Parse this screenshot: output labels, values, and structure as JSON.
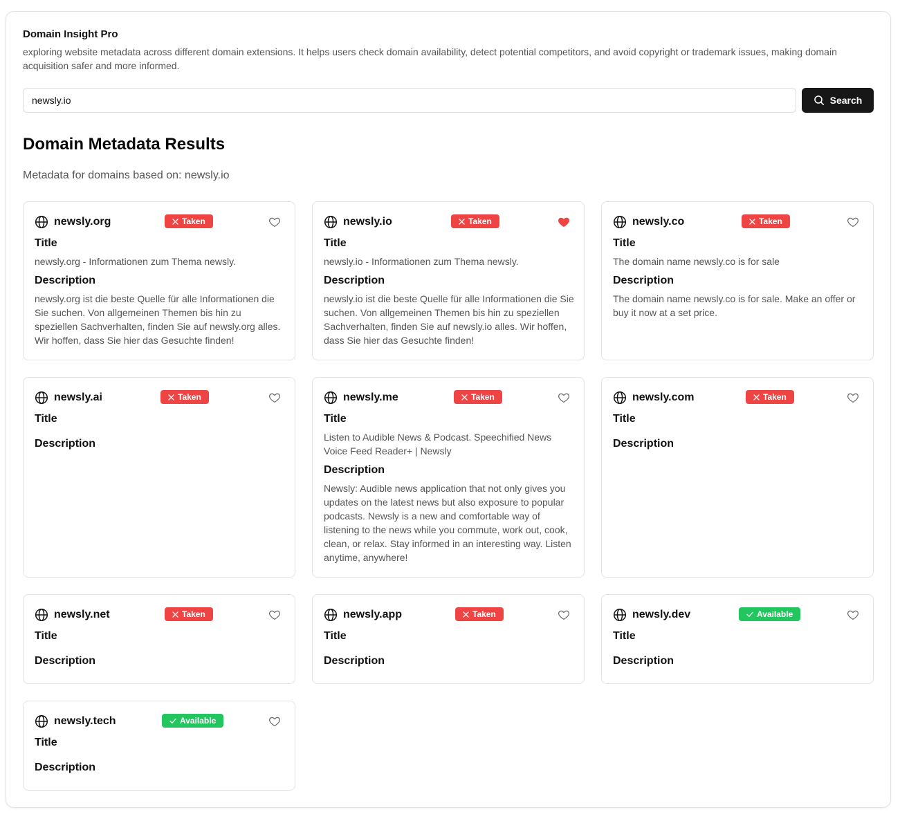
{
  "app": {
    "title": "Domain Insight Pro",
    "description": "exploring website metadata across different domain extensions. It helps users check domain availability, detect potential competitors, and avoid copyright or trademark issues, making domain acquisition safer and more informed."
  },
  "search": {
    "value": "newsly.io",
    "placeholder": "",
    "button_label": "Search"
  },
  "results": {
    "heading": "Domain Metadata Results",
    "subtitle_prefix": "Metadata for domains based on: ",
    "subtitle_query": "newsly.io"
  },
  "labels": {
    "title": "Title",
    "description": "Description"
  },
  "colors": {
    "taken": "#ef4444",
    "available": "#22c55e",
    "favorite": "#ef4444",
    "button": "#171717"
  },
  "cards": [
    {
      "domain": "newsly.org",
      "status": "Taken",
      "favorite": false,
      "title": "newsly.org - Informationen zum Thema newsly.",
      "description": "newsly.org ist die beste Quelle für alle Informationen die Sie suchen. Von allgemeinen Themen bis hin zu speziellen Sachverhalten, finden Sie auf newsly.org alles. Wir hoffen, dass Sie hier das Gesuchte finden!"
    },
    {
      "domain": "newsly.io",
      "status": "Taken",
      "favorite": true,
      "title": "newsly.io - Informationen zum Thema newsly.",
      "description": "newsly.io ist die beste Quelle für alle Informationen die Sie suchen. Von allgemeinen Themen bis hin zu speziellen Sachverhalten, finden Sie auf newsly.io alles. Wir hoffen, dass Sie hier das Gesuchte finden!"
    },
    {
      "domain": "newsly.co",
      "status": "Taken",
      "favorite": false,
      "title": "The domain name newsly.co is for sale",
      "description": "The domain name newsly.co is for sale. Make an offer or buy it now at a set price."
    },
    {
      "domain": "newsly.ai",
      "status": "Taken",
      "favorite": false,
      "title": "",
      "description": ""
    },
    {
      "domain": "newsly.me",
      "status": "Taken",
      "favorite": false,
      "title": "Listen to Audible News & Podcast. Speechified News Voice Feed Reader+ | Newsly",
      "description": "Newsly: Audible news application that not only gives you updates on the latest news but also exposure to popular podcasts. Newsly is a new and comfortable way of listening to the news while you commute, work out, cook, clean, or relax. Stay informed in an interesting way. Listen anytime, anywhere!"
    },
    {
      "domain": "newsly.com",
      "status": "Taken",
      "favorite": false,
      "title": "",
      "description": ""
    },
    {
      "domain": "newsly.net",
      "status": "Taken",
      "favorite": false,
      "title": "",
      "description": ""
    },
    {
      "domain": "newsly.app",
      "status": "Taken",
      "favorite": false,
      "title": "",
      "description": ""
    },
    {
      "domain": "newsly.dev",
      "status": "Available",
      "favorite": false,
      "title": "",
      "description": ""
    },
    {
      "domain": "newsly.tech",
      "status": "Available",
      "favorite": false,
      "title": "",
      "description": ""
    }
  ]
}
